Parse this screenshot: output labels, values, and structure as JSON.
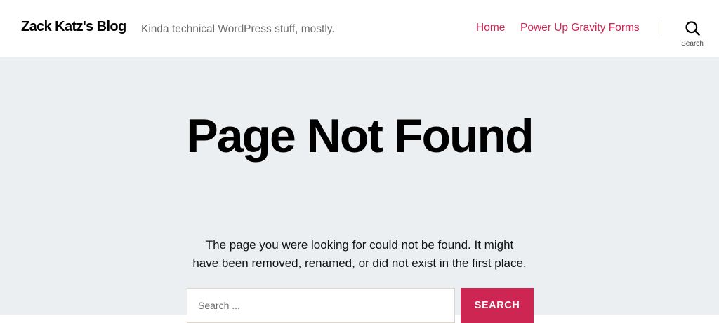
{
  "header": {
    "site_title": "Zack Katz's Blog",
    "tagline": "Kinda technical WordPress stuff, mostly.",
    "nav": [
      {
        "label": "Home"
      },
      {
        "label": "Power Up Gravity Forms"
      }
    ],
    "search_toggle_label": "Search",
    "search_icon": "search-icon"
  },
  "main": {
    "title": "Page Not Found",
    "message_lines": [
      "The page you were looking for could not be found. It might",
      "have been removed, renamed, or did not exist in the first place."
    ],
    "search": {
      "placeholder": "Search ...",
      "value": "",
      "submit_label": "SEARCH"
    }
  },
  "colors": {
    "accent": "#cd2653",
    "main_background": "#eceff1",
    "header_background": "#ffffff",
    "tagline": "#6d6d6d"
  }
}
